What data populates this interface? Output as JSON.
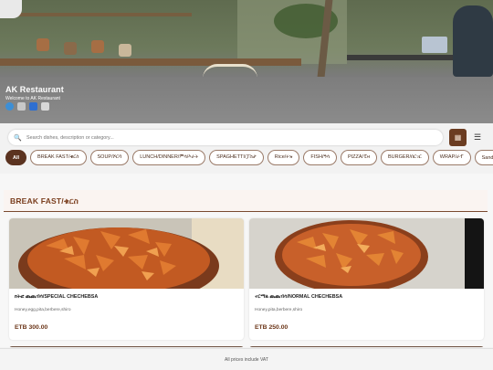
{
  "restaurant": {
    "name": "AK Restaurant",
    "tagline": "Welcome to AK Restaurant",
    "social_icons": [
      "globe-icon",
      "phone-icon",
      "facebook-icon",
      "instagram-icon"
    ]
  },
  "search": {
    "placeholder": "Search dishes, description or category..."
  },
  "view_toggles": {
    "grid_icon": "grid-icon",
    "list_icon": "list-icon",
    "grid_glyph": "▦",
    "list_glyph": "☰"
  },
  "categories": [
    {
      "label": "All",
      "active": true
    },
    {
      "label": "BREAK FAST/ቁርስ",
      "active": false
    },
    {
      "label": "SOUP/ሾርባ",
      "active": false
    },
    {
      "label": "LUNCH/DINNER/ምሳ/እራት",
      "active": false
    },
    {
      "label": "SPAGHETTI/ፓስታ",
      "active": false
    },
    {
      "label": "Rice/ሩዝ",
      "active": false
    },
    {
      "label": "FISH/ዓሳ",
      "active": false
    },
    {
      "label": "PIZZA/ፒዛ",
      "active": false
    },
    {
      "label": "BURGER/በርገር",
      "active": false
    },
    {
      "label": "WRAP/ራፕ",
      "active": false
    },
    {
      "label": "Sandw",
      "active": false
    }
  ],
  "section": {
    "title": "BREAK FAST/ቁርስ"
  },
  "items": [
    {
      "name": "ክትፎ ጨጨብሳ/SPECIAL CHECHEBSA",
      "description": "Honey,egg,pita,berbere,shiro",
      "price": "ETB 300.00"
    },
    {
      "name": "ኖርማል ጨጨብሳ/NORMAL CHECHEBSA",
      "description": "Honey,pita,berbere,shiro",
      "price": "ETB 250.00"
    }
  ],
  "footer": {
    "note": "All prices include VAT"
  },
  "colors": {
    "accent": "#5b3320",
    "price": "#6b3518",
    "section_title": "#7a3e1e"
  }
}
